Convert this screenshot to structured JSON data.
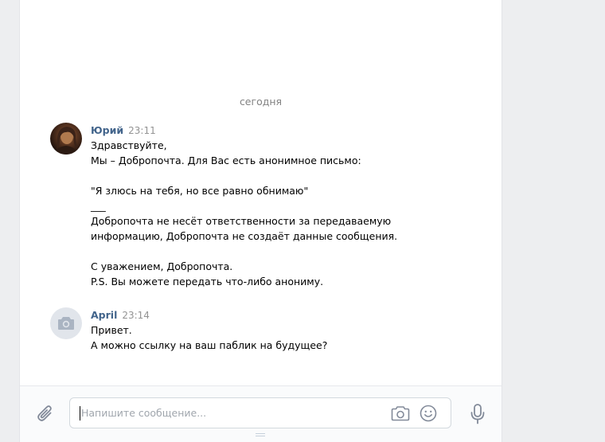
{
  "chat": {
    "date_divider": "сегодня",
    "messages": [
      {
        "author": "Юрий",
        "time": "23:11",
        "avatar": "user-photo",
        "lines": [
          "Здравствуйте,",
          "Мы – Добропочта. Для Вас есть анонимное письмо:",
          "",
          "\"Я злюсь на тебя, но все равно обнимаю\"",
          "___",
          "Добропочта не несёт ответственности за передаваемую",
          "информацию, Добропочта не создаёт данные сообщения.",
          "",
          "С уважением, Добропочта.",
          "P.S. Вы можете передать что-либо анониму."
        ]
      },
      {
        "author": "April",
        "time": "23:14",
        "avatar": "camera-placeholder-icon",
        "lines": [
          "Привет.",
          "А можно ссылку на ваш паблик на будущее?"
        ]
      }
    ]
  },
  "composer": {
    "placeholder": "Напишите сообщение...",
    "value": "",
    "icons": {
      "attach": "paperclip-icon",
      "camera": "camera-icon",
      "emoji": "smiley-icon",
      "voice": "microphone-icon"
    }
  },
  "colors": {
    "page_background": "#edeef0",
    "panel_background": "#ffffff",
    "author_name": "#42648b",
    "timestamp": "#939393",
    "icon": "#828a99"
  }
}
